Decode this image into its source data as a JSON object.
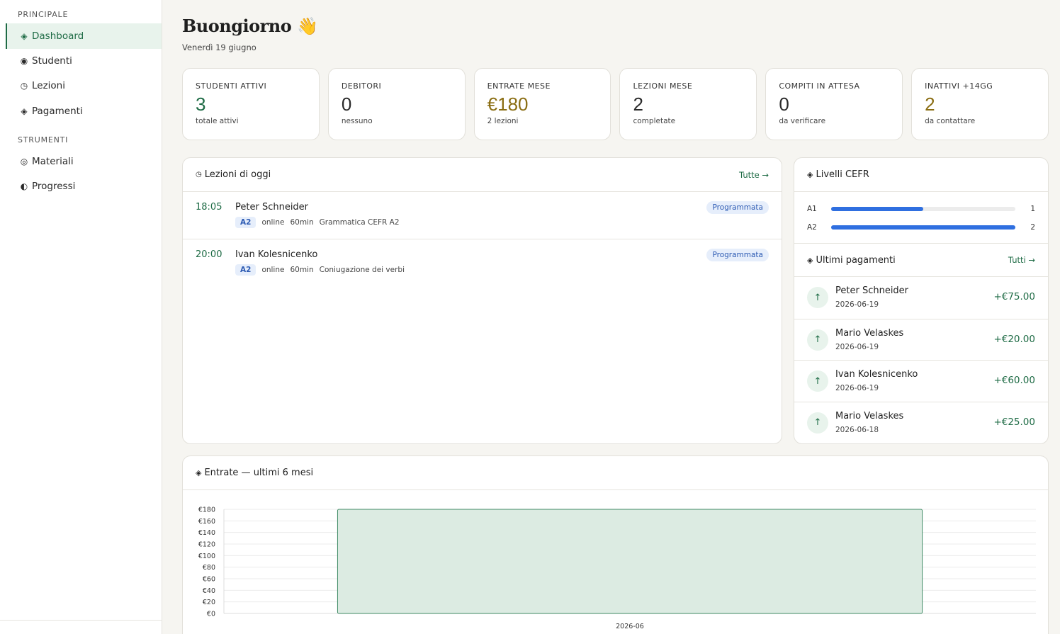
{
  "sidebar": {
    "sections": [
      {
        "label": "PRINCIPALE",
        "items": [
          {
            "label": "Dashboard",
            "icon": "◈",
            "icon_name": "diamond-icon",
            "active": true
          },
          {
            "label": "Studenti",
            "icon": "◉",
            "icon_name": "students-icon"
          },
          {
            "label": "Lezioni",
            "icon": "◷",
            "icon_name": "clock-icon"
          },
          {
            "label": "Pagamenti",
            "icon": "◈",
            "icon_name": "payments-icon"
          }
        ]
      },
      {
        "label": "STRUMENTI",
        "items": [
          {
            "label": "Materiali",
            "icon": "◎",
            "icon_name": "materials-icon"
          },
          {
            "label": "Progressi",
            "icon": "◐",
            "icon_name": "progress-icon"
          }
        ]
      }
    ]
  },
  "header": {
    "greeting": "Buongiorno 👋",
    "date": "Venerdì 19 giugno"
  },
  "stats": [
    {
      "label": "STUDENTI ATTIVI",
      "value": "3",
      "sub": "totale attivi",
      "color": "#1e6b45"
    },
    {
      "label": "DEBITORI",
      "value": "0",
      "sub": "nessuno",
      "color": "#2a2a2a"
    },
    {
      "label": "ENTRATE MESE",
      "value": "€180",
      "sub": "2 lezioni",
      "color": "#8a6d12"
    },
    {
      "label": "LEZIONI MESE",
      "value": "2",
      "sub": "completate",
      "color": "#2a2a2a"
    },
    {
      "label": "COMPITI IN ATTESA",
      "value": "0",
      "sub": "da verificare",
      "color": "#2a2a2a"
    },
    {
      "label": "INATTIVI +14GG",
      "value": "2",
      "sub": "da contattare",
      "color": "#8a6d12"
    }
  ],
  "lessons_card": {
    "title": "Lezioni di oggi",
    "link": "Tutte →",
    "lessons": [
      {
        "time": "18:05",
        "name": "Peter Schneider",
        "level": "A2",
        "mode": "online",
        "duration": "60min",
        "topic": "Grammatica CEFR A2",
        "status": "Programmata"
      },
      {
        "time": "20:00",
        "name": "Ivan Kolesnicenko",
        "level": "A2",
        "mode": "online",
        "duration": "60min",
        "topic": "Coniugazione dei verbi",
        "status": "Programmata"
      }
    ]
  },
  "cefr_card": {
    "title": "Livelli CEFR",
    "levels": [
      {
        "label": "A1",
        "count": "1",
        "fraction": 0.5
      },
      {
        "label": "A2",
        "count": "2",
        "fraction": 1.0
      }
    ]
  },
  "payments_card": {
    "title": "Ultimi pagamenti",
    "link": "Tutti →",
    "payments": [
      {
        "name": "Peter Schneider",
        "date": "2026-06-19",
        "amount": "+€75.00"
      },
      {
        "name": "Mario Velaskes",
        "date": "2026-06-19",
        "amount": "+€20.00"
      },
      {
        "name": "Ivan Kolesnicenko",
        "date": "2026-06-19",
        "amount": "+€60.00"
      },
      {
        "name": "Mario Velaskes",
        "date": "2026-06-18",
        "amount": "+€25.00"
      }
    ]
  },
  "revenue_card": {
    "title": "Entrate — ultimi 6 mesi"
  },
  "chart_data": {
    "type": "bar",
    "categories": [
      "2026-06"
    ],
    "values": [
      180
    ],
    "ylim": [
      0,
      180
    ],
    "yticks": [
      0,
      20,
      40,
      60,
      80,
      100,
      120,
      140,
      160,
      180
    ],
    "ytick_prefix": "€",
    "grid": true,
    "bar_fill": "#dcebe2",
    "bar_stroke": "#3f8a64"
  },
  "colors": {
    "accent": "#1e6b45",
    "cefr_bar": "#2f6fe0",
    "badge_bg": "#e6eefb",
    "badge_text": "#2d5bb3"
  }
}
